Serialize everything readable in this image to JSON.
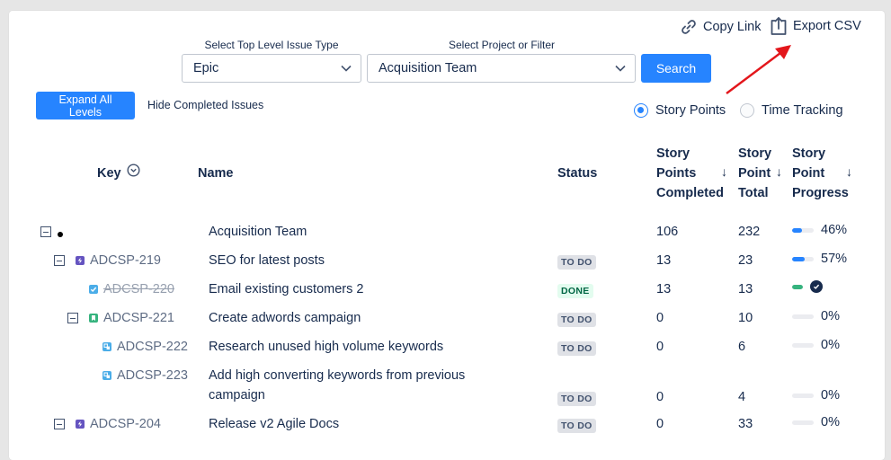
{
  "actions": {
    "copy_link": "Copy Link",
    "export_csv": "Export CSV"
  },
  "filters": {
    "issue_type_label": "Select Top Level Issue Type",
    "issue_type_value": "Epic",
    "project_label": "Select Project or Filter",
    "project_value": "Acquisition Team",
    "search_label": "Search"
  },
  "toolbar": {
    "expand_all": "Expand All Levels",
    "hide_completed": "Hide Completed Issues"
  },
  "estimation": {
    "story_points": "Story Points",
    "time_tracking": "Time Tracking",
    "selected": "story_points"
  },
  "columns": {
    "key": "Key",
    "name": "Name",
    "status": "Status",
    "completed": [
      "Story",
      "Points",
      "Completed"
    ],
    "total": [
      "Story",
      "Point",
      "Total"
    ],
    "progress": [
      "Story",
      "Point",
      "Progress"
    ]
  },
  "colors": {
    "accent": "#2684ff",
    "progress_blue": "#2684ff",
    "progress_green": "#36b37e",
    "epic": "#6554c0",
    "story": "#36b37e",
    "task": "#4bade8",
    "subtask": "#4bade8"
  },
  "rows": [
    {
      "level": 0,
      "toggle": true,
      "bullet": true,
      "type": "",
      "key": "",
      "name": [
        "Acquisition Team"
      ],
      "status": "",
      "completed": "106",
      "total": "232",
      "progress": 0.46,
      "progress_label": "46%",
      "done": false
    },
    {
      "level": 1,
      "toggle": true,
      "bullet": false,
      "type": "epic",
      "key": "ADCSP-219",
      "name": [
        "SEO for latest posts"
      ],
      "status": "TO DO",
      "completed": "13",
      "total": "23",
      "progress": 0.57,
      "progress_label": "57%",
      "done": false
    },
    {
      "level": 2,
      "toggle": false,
      "bullet": false,
      "type": "task",
      "key": "ADCSP-220",
      "name": [
        "Email existing customers 2"
      ],
      "status": "DONE",
      "completed": "13",
      "total": "13",
      "progress": 1.0,
      "progress_label": "",
      "done": true
    },
    {
      "level": 2,
      "toggle": true,
      "bullet": false,
      "type": "story",
      "key": "ADCSP-221",
      "name": [
        "Create adwords campaign"
      ],
      "status": "TO DO",
      "completed": "0",
      "total": "10",
      "progress": 0,
      "progress_label": "0%",
      "done": false
    },
    {
      "level": 3,
      "toggle": false,
      "bullet": false,
      "type": "subtask",
      "key": "ADCSP-222",
      "name": [
        "Research unused high volume keywords"
      ],
      "status": "TO DO",
      "completed": "0",
      "total": "6",
      "progress": 0,
      "progress_label": "0%",
      "done": false
    },
    {
      "level": 3,
      "toggle": false,
      "bullet": false,
      "type": "subtask",
      "key": "ADCSP-223",
      "name": [
        "Add high converting keywords from previous",
        "campaign"
      ],
      "status": "TO DO",
      "completed": "0",
      "total": "4",
      "progress": 0,
      "progress_label": "0%",
      "done": false
    },
    {
      "level": 1,
      "toggle": true,
      "bullet": false,
      "type": "epic",
      "key": "ADCSP-204",
      "name": [
        "Release v2 Agile Docs"
      ],
      "status": "TO DO",
      "completed": "0",
      "total": "33",
      "progress": 0,
      "progress_label": "0%",
      "done": false
    }
  ]
}
